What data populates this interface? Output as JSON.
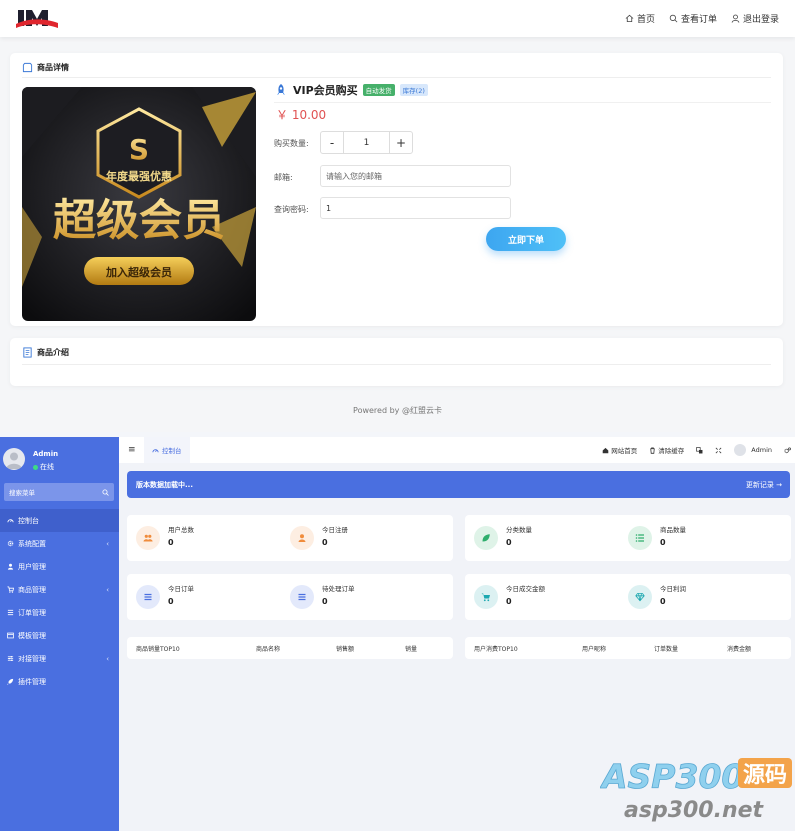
{
  "store": {
    "nav": [
      {
        "label": "首页",
        "icon": "home-icon"
      },
      {
        "label": "查看订单",
        "icon": "search-icon"
      },
      {
        "label": "退出登录",
        "icon": "user-icon"
      }
    ],
    "detail_title": "商品详情",
    "product": {
      "name": "VIP会员购买",
      "badge_auto": "自动发货",
      "badge_stock": "库存(2)",
      "price": "￥ 10.00",
      "image_lines": [
        "年度最强优惠",
        "超级会员",
        "加入超级会员"
      ]
    },
    "form": {
      "qty_label": "购买数量:",
      "qty_minus": "-",
      "qty_value": "1",
      "qty_plus": "+",
      "email_label": "邮箱:",
      "email_placeholder": "请输入您的邮箱",
      "pwd_label": "查询密码:",
      "pwd_value": "1",
      "submit": "立即下单"
    },
    "intro_title": "商品介绍",
    "footer": "Powered by @红盟云卡"
  },
  "admin": {
    "user": {
      "name": "Admin",
      "status": "在线"
    },
    "search_placeholder": "搜索菜单",
    "menu": [
      {
        "label": "控制台",
        "active": true,
        "chevron": false
      },
      {
        "label": "系统配置",
        "active": false,
        "chevron": true
      },
      {
        "label": "用户管理",
        "active": false,
        "chevron": false
      },
      {
        "label": "商品管理",
        "active": false,
        "chevron": true
      },
      {
        "label": "订单管理",
        "active": false,
        "chevron": false
      },
      {
        "label": "模板管理",
        "active": false,
        "chevron": false
      },
      {
        "label": "对接管理",
        "active": false,
        "chevron": true
      },
      {
        "label": "插件管理",
        "active": false,
        "chevron": false
      }
    ],
    "tab": "控制台",
    "topbar": {
      "site_home": "网站首页",
      "clear_cache": "清除缓存",
      "user": "Admin"
    },
    "notice": {
      "text": "版本数据加载中...",
      "link": "更新记录 →"
    },
    "stats": [
      {
        "label": "用户总数",
        "value": "0",
        "color": "#f08c3c",
        "bg": "#fdeee2",
        "icon": "users-icon"
      },
      {
        "label": "今日注册",
        "value": "0",
        "color": "#f08c3c",
        "bg": "#fdeee2",
        "icon": "user-icon"
      },
      {
        "label": "分类数量",
        "value": "0",
        "color": "#2fae6d",
        "bg": "#dff3e8",
        "icon": "leaf-icon"
      },
      {
        "label": "商品数量",
        "value": "0",
        "color": "#2fae6d",
        "bg": "#dff3e8",
        "icon": "list-icon"
      },
      {
        "label": "今日订单",
        "value": "0",
        "color": "#4a6fe0",
        "bg": "#e3e9fb",
        "icon": "menu-icon"
      },
      {
        "label": "待处理订单",
        "value": "0",
        "color": "#4a6fe0",
        "bg": "#e3e9fb",
        "icon": "menu-icon"
      },
      {
        "label": "今日成交金额",
        "value": "0",
        "color": "#1ca8b0",
        "bg": "#dcf1f2",
        "icon": "cart-icon"
      },
      {
        "label": "今日利润",
        "value": "0",
        "color": "#1ca8b0",
        "bg": "#dcf1f2",
        "icon": "diamond-icon"
      }
    ],
    "table_left": [
      "商品销量TOP10",
      "商品名称",
      "销售额",
      "销量"
    ],
    "table_right": [
      "用户消费TOP10",
      "用户昵称",
      "订单数量",
      "消费金额"
    ]
  },
  "watermark": {
    "brand": "ASP300",
    "brand_cn": "源码",
    "url": "asp300.net"
  }
}
